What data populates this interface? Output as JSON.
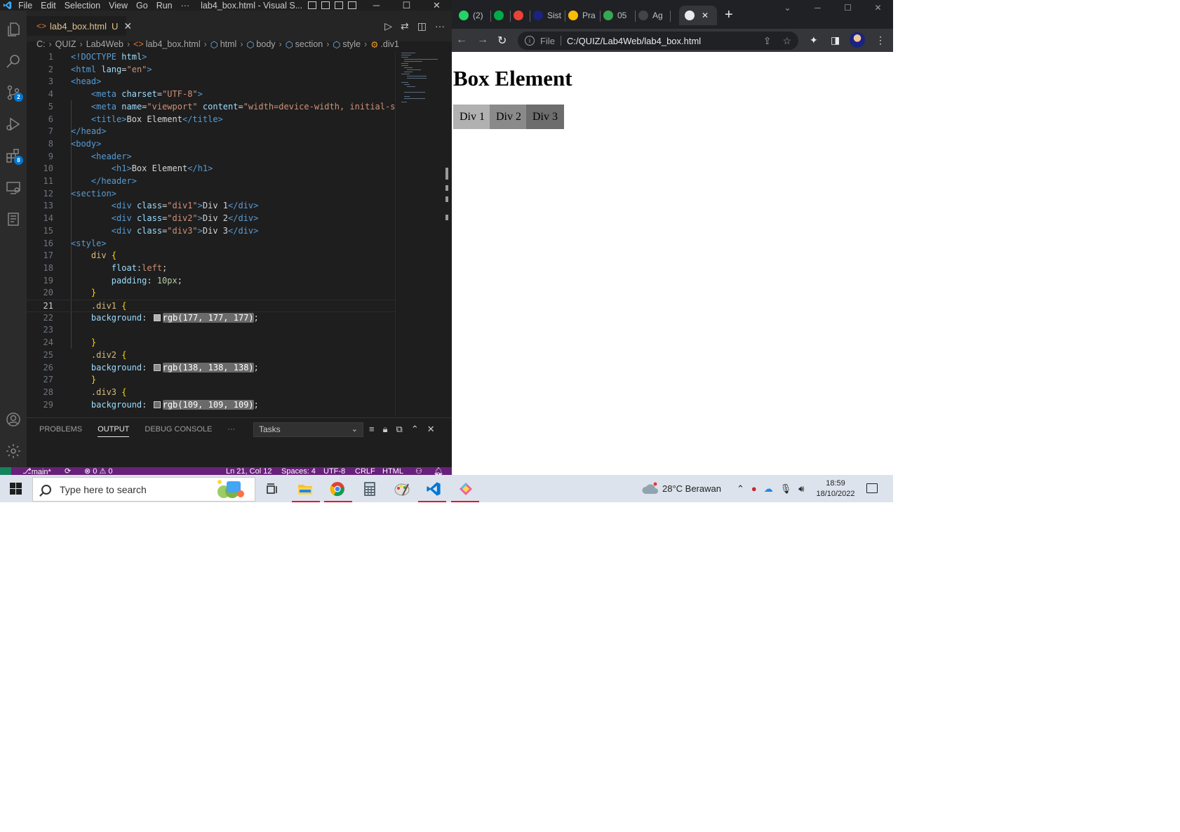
{
  "vscode": {
    "menu": [
      "File",
      "Edit",
      "Selection",
      "View",
      "Go",
      "Run",
      "···"
    ],
    "window_title": "lab4_box.html - Visual S...",
    "tab": {
      "label": "lab4_box.html",
      "status": "U"
    },
    "breadcrumb": [
      "C:",
      "QUIZ",
      "Lab4Web",
      "lab4_box.html",
      "html",
      "body",
      "section",
      "style",
      ".div1"
    ],
    "activity_badges": {
      "source_control": "2",
      "extensions": "8"
    },
    "code_lines": [
      {
        "n": "1",
        "html": "<span class='t-tag'>&lt;!DOCTYPE</span> <span class='t-att'>html</span><span class='t-tag'>&gt;</span>"
      },
      {
        "n": "2",
        "html": "<span class='t-tag'>&lt;html</span> <span class='t-att'>lang</span>=<span class='t-str'>\"en\"</span><span class='t-tag'>&gt;</span>"
      },
      {
        "n": "3",
        "html": "<span class='t-tag'>&lt;head&gt;</span>"
      },
      {
        "n": "4",
        "html": "    <span class='t-tag'>&lt;meta</span> <span class='t-att'>charset</span>=<span class='t-str'>\"UTF-8\"</span><span class='t-tag'>&gt;</span>"
      },
      {
        "n": "5",
        "html": "    <span class='t-tag'>&lt;meta</span> <span class='t-att'>name</span>=<span class='t-str'>\"viewport\"</span> <span class='t-att'>content</span>=<span class='t-str'>\"width=device-width, initial-sc</span>"
      },
      {
        "n": "6",
        "html": "    <span class='t-tag'>&lt;title&gt;</span>Box Element<span class='t-tag'>&lt;/title&gt;</span>"
      },
      {
        "n": "7",
        "html": "<span class='t-tag'>&lt;/head&gt;</span>"
      },
      {
        "n": "8",
        "html": "<span class='t-tag'>&lt;body&gt;</span>"
      },
      {
        "n": "9",
        "html": "    <span class='t-tag'>&lt;header&gt;</span>"
      },
      {
        "n": "10",
        "html": "        <span class='t-tag'>&lt;h1&gt;</span>Box Element<span class='t-tag'>&lt;/h1&gt;</span>"
      },
      {
        "n": "11",
        "html": "    <span class='t-tag'>&lt;/header&gt;</span>"
      },
      {
        "n": "12",
        "html": "<span class='t-tag'>&lt;section&gt;</span>"
      },
      {
        "n": "13",
        "html": "        <span class='t-tag'>&lt;div</span> <span class='t-att'>class</span>=<span class='t-str'>\"div1\"</span><span class='t-tag'>&gt;</span>Div 1<span class='t-tag'>&lt;/div&gt;</span>"
      },
      {
        "n": "14",
        "html": "        <span class='t-tag'>&lt;div</span> <span class='t-att'>class</span>=<span class='t-str'>\"div2\"</span><span class='t-tag'>&gt;</span>Div 2<span class='t-tag'>&lt;/div&gt;</span>"
      },
      {
        "n": "15",
        "html": "        <span class='t-tag'>&lt;div</span> <span class='t-att'>class</span>=<span class='t-str'>\"div3\"</span><span class='t-tag'>&gt;</span>Div 3<span class='t-tag'>&lt;/div&gt;</span>"
      },
      {
        "n": "16",
        "html": "<span class='t-tag'>&lt;style&gt;</span>"
      },
      {
        "n": "17",
        "html": "    <span class='t-sel'>div</span> <span class='t-br'>{</span>"
      },
      {
        "n": "18",
        "html": "        <span class='t-att'>float</span>:<span class='t-val'>left</span>;"
      },
      {
        "n": "19",
        "html": "        <span class='t-att'>padding</span>: <span class='t-num'>10px</span>;"
      },
      {
        "n": "20",
        "html": "    <span class='t-br'>}</span>"
      },
      {
        "n": "21",
        "html": "    <span class='t-sel'>.div1</span> <span class='t-br'>{</span>"
      },
      {
        "n": "22",
        "html": "    <span class='t-att'>background</span>: <span class='swatch' style='background:#b1b1b1'></span><span class='hl'>rgb(177, 177, 177)</span>;"
      },
      {
        "n": "23",
        "html": ""
      },
      {
        "n": "24",
        "html": "    <span class='t-br'>}</span>"
      },
      {
        "n": "25",
        "html": "    <span class='t-sel'>.div2</span> <span class='t-br'>{</span>"
      },
      {
        "n": "26",
        "html": "    <span class='t-att'>background</span>: <span class='swatch' style='background:#8a8a8a'></span><span class='hl'>rgb(138, 138, 138)</span>;"
      },
      {
        "n": "27",
        "html": "    <span class='t-br'>}</span>"
      },
      {
        "n": "28",
        "html": "    <span class='t-sel'>.div3</span> <span class='t-br'>{</span>"
      },
      {
        "n": "29",
        "html": "    <span class='t-att'>background</span>: <span class='swatch' style='background:#6d6d6d'></span><span class='hl'>rgb(109, 109, 109)</span>;"
      }
    ],
    "current_line": "21",
    "panel": {
      "tabs": [
        "PROBLEMS",
        "OUTPUT",
        "DEBUG CONSOLE",
        "···"
      ],
      "active_tab": "OUTPUT",
      "task_select": "Tasks"
    },
    "statusbar": {
      "branch": "main*",
      "problems": "⊗ 0 ⚠ 0",
      "position": "Ln 21, Col 12",
      "spaces": "Spaces: 4",
      "encoding": "UTF-8",
      "eol": "CRLF",
      "language": "HTML"
    }
  },
  "chrome": {
    "tabs": [
      {
        "label": "(2)",
        "color": "#25d366"
      },
      {
        "label": "",
        "color": "#00ac47"
      },
      {
        "label": "",
        "color": "#ea4335"
      },
      {
        "label": "Sist",
        "color": "#1a237e"
      },
      {
        "label": "Pra",
        "color": "#fbbc04"
      },
      {
        "label": "05",
        "color": "#34a853"
      },
      {
        "label": "Ag",
        "color": "#444444"
      }
    ],
    "active_tab_label": "",
    "address": {
      "scheme": "File",
      "url": "C:/QUIZ/Lab4Web/lab4_box.html"
    },
    "page": {
      "heading": "Box Element",
      "boxes": [
        {
          "label": "Div 1",
          "color": "#b1b1b1"
        },
        {
          "label": "Div 2",
          "color": "#8a8a8a"
        },
        {
          "label": "Div 3",
          "color": "#6d6d6d"
        }
      ]
    }
  },
  "taskbar": {
    "search_placeholder": "Type here to search",
    "weather": "28°C  Berawan",
    "time": "18:59",
    "date": "18/10/2022"
  }
}
